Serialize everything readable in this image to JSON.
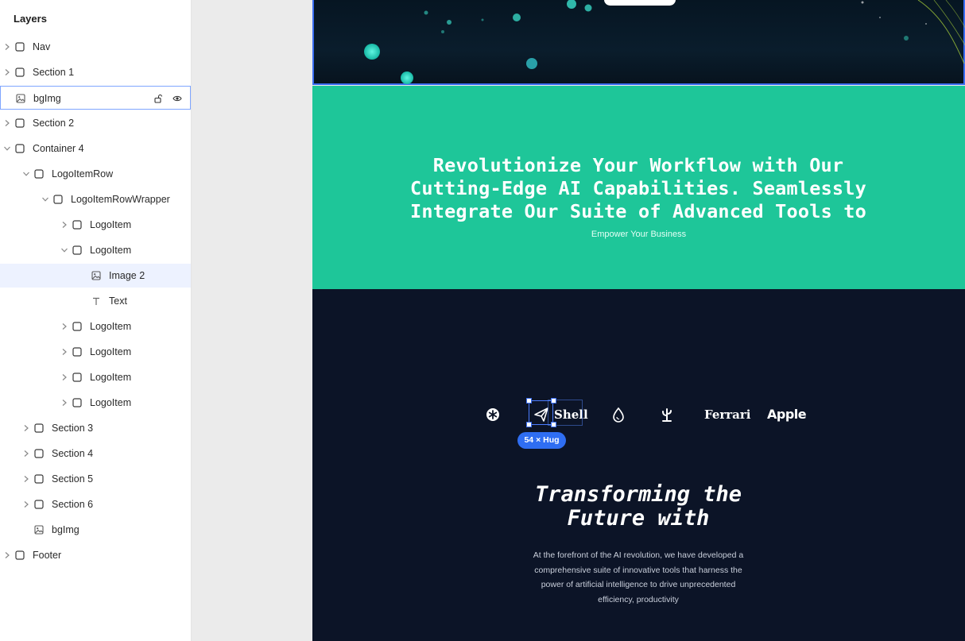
{
  "panel": {
    "title": "Layers",
    "layers": [
      {
        "label": "Nav",
        "icon": "frame-icon",
        "expander": "chevron-right"
      },
      {
        "label": "Section 1",
        "icon": "frame-icon",
        "expander": "chevron-right"
      },
      {
        "label": "bgImg",
        "icon": "image-icon",
        "expander": "",
        "state": "selected",
        "controls": [
          "lock-open-icon",
          "eye-icon"
        ]
      },
      {
        "label": "Section 2",
        "icon": "frame-icon",
        "expander": "chevron-right"
      },
      {
        "label": "Container 4",
        "icon": "frame-icon",
        "expander": "chevron-down"
      },
      {
        "label": "LogoItemRow",
        "icon": "frame-icon",
        "expander": "chevron-down"
      },
      {
        "label": "LogoItemRowWrapper",
        "icon": "frame-icon",
        "expander": "chevron-down"
      },
      {
        "label": "LogoItem",
        "icon": "frame-icon",
        "expander": "chevron-right"
      },
      {
        "label": "LogoItem",
        "icon": "frame-icon",
        "expander": "chevron-down"
      },
      {
        "label": "Image 2",
        "icon": "image-icon",
        "expander": "",
        "state": "highlighted"
      },
      {
        "label": "Text",
        "icon": "text-icon",
        "expander": ""
      },
      {
        "label": "LogoItem",
        "icon": "frame-icon",
        "expander": "chevron-right"
      },
      {
        "label": "LogoItem",
        "icon": "frame-icon",
        "expander": "chevron-right"
      },
      {
        "label": "LogoItem",
        "icon": "frame-icon",
        "expander": "chevron-right"
      },
      {
        "label": "LogoItem",
        "icon": "frame-icon",
        "expander": "chevron-right"
      },
      {
        "label": "Section 3",
        "icon": "frame-icon",
        "expander": "chevron-right"
      },
      {
        "label": "Section 4",
        "icon": "frame-icon",
        "expander": "chevron-right"
      },
      {
        "label": "Section 5",
        "icon": "frame-icon",
        "expander": "chevron-right"
      },
      {
        "label": "Section 6",
        "icon": "frame-icon",
        "expander": "chevron-right"
      },
      {
        "label": "bgImg",
        "icon": "image-icon",
        "expander": ""
      },
      {
        "label": "Footer",
        "icon": "frame-icon",
        "expander": "chevron-right"
      }
    ]
  },
  "canvas": {
    "green_section": {
      "heading": "Revolutionize Your Workflow with Our Cutting-Edge AI Capabilities. Seamlessly Integrate Our Suite of Advanced Tools to",
      "subheading": "Empower Your Business"
    },
    "logos": [
      {
        "name": "asterisk-logo-icon",
        "text": ""
      },
      {
        "name": "paper-plane-logo-icon",
        "text": ""
      },
      {
        "name": "shell-logo",
        "text": "Shell"
      },
      {
        "name": "drop-logo-icon",
        "text": ""
      },
      {
        "name": "cactus-logo-icon",
        "text": ""
      },
      {
        "name": "ferrari-logo",
        "text": "Ferrari"
      },
      {
        "name": "apple-logo",
        "text": "Apple"
      }
    ],
    "selection_badge": "54 × Hug",
    "dark_section": {
      "heading": "Transforming the Future with",
      "body": "At the forefront of the AI revolution, we have developed a comprehensive suite of innovative tools that harness the power of artificial intelligence to drive unprecedented efficiency, productivity"
    },
    "colors": {
      "accent_green": "#1ec699",
      "dark_bg": "#0c1427",
      "selection_blue": "#3a6df0"
    }
  }
}
